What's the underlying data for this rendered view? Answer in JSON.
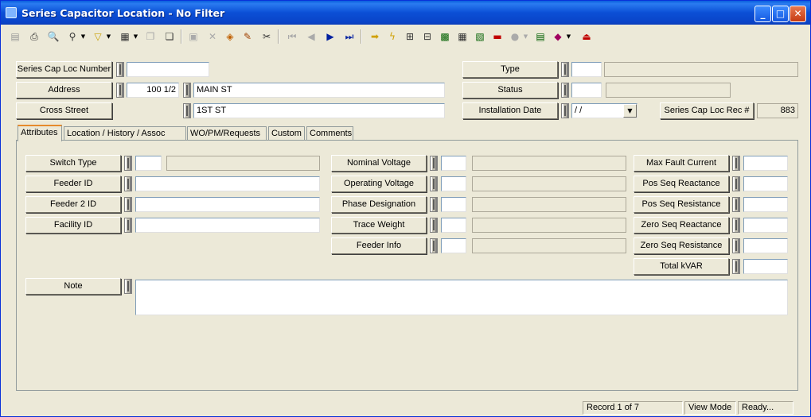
{
  "window": {
    "title": "Series Capacitor Location - No Filter"
  },
  "header": {
    "series_cap_loc_number": {
      "label": "Series Cap Loc Number",
      "value": ""
    },
    "address": {
      "label": "Address",
      "number": "100 1/2",
      "street": "MAIN ST"
    },
    "cross_street": {
      "label": "Cross Street",
      "value": "1ST ST"
    },
    "type": {
      "label": "Type",
      "code": "",
      "desc": ""
    },
    "status": {
      "label": "Status",
      "code": "",
      "desc": ""
    },
    "installation_date": {
      "label": "Installation Date",
      "value": " /  /"
    },
    "rec_number": {
      "label": "Series Cap Loc Rec #",
      "value": "883"
    }
  },
  "tabs": [
    {
      "label": "Attributes"
    },
    {
      "label": "Location / History / Assoc"
    },
    {
      "label": "WO/PM/Requests"
    },
    {
      "label": "Custom"
    },
    {
      "label": "Comments"
    }
  ],
  "attributes": {
    "switch_type": {
      "label": "Switch Type",
      "code": "",
      "desc": ""
    },
    "feeder_id": {
      "label": "Feeder ID",
      "value": ""
    },
    "feeder2_id": {
      "label": "Feeder 2 ID",
      "value": ""
    },
    "facility_id": {
      "label": "Facility ID",
      "value": ""
    },
    "nominal_voltage": {
      "label": "Nominal Voltage",
      "code": "",
      "desc": ""
    },
    "operating_voltage": {
      "label": "Operating Voltage",
      "code": "",
      "desc": ""
    },
    "phase_designation": {
      "label": "Phase Designation",
      "code": "",
      "desc": ""
    },
    "trace_weight": {
      "label": "Trace Weight",
      "code": "",
      "desc": ""
    },
    "feeder_info": {
      "label": "Feeder Info",
      "code": "",
      "desc": ""
    },
    "max_fault_current": {
      "label": "Max Fault Current",
      "value": ""
    },
    "pos_seq_reactance": {
      "label": "Pos Seq Reactance",
      "value": ""
    },
    "pos_seq_resistance": {
      "label": "Pos Seq Resistance",
      "value": ""
    },
    "zero_seq_reactance": {
      "label": "Zero Seq Reactance",
      "value": ""
    },
    "zero_seq_resistance": {
      "label": "Zero Seq Resistance",
      "value": ""
    },
    "total_kvar": {
      "label": "Total kVAR",
      "value": ""
    },
    "note": {
      "label": "Note",
      "value": ""
    }
  },
  "statusbar": {
    "record": "Record 1 of 7",
    "mode": "View Mode",
    "state": "Ready..."
  }
}
